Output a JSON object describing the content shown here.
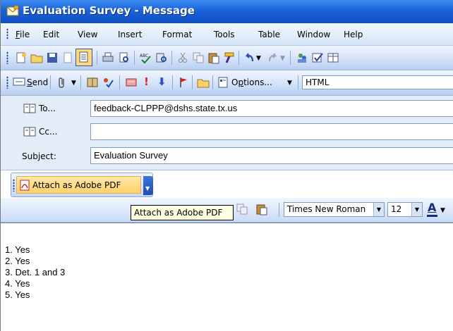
{
  "window": {
    "title": "Evaluation Survey - Message"
  },
  "menu": [
    "File",
    "Edit",
    "View",
    "Insert",
    "Format",
    "Tools",
    "Table",
    "Window",
    "Help"
  ],
  "send_toolbar": {
    "send_label": "Send",
    "options_label": "Options...",
    "format_value": "HTML"
  },
  "fields": {
    "to_label": "To...",
    "to_value": "feedback-CLPPP@dshs.state.tx.us",
    "cc_label": "Cc...",
    "cc_value": "",
    "subject_label": "Subject:",
    "subject_value": "Evaluation Survey"
  },
  "pdf_toolbar": {
    "button_label": "Attach as Adobe PDF",
    "tooltip": "Attach as Adobe PDF"
  },
  "format_toolbar": {
    "font": "Times New Roman",
    "size": "12"
  },
  "body_lines": [
    "1. Yes",
    "2. Yes",
    "3. Det. 1 and 3",
    "4. Yes",
    "5. Yes"
  ]
}
